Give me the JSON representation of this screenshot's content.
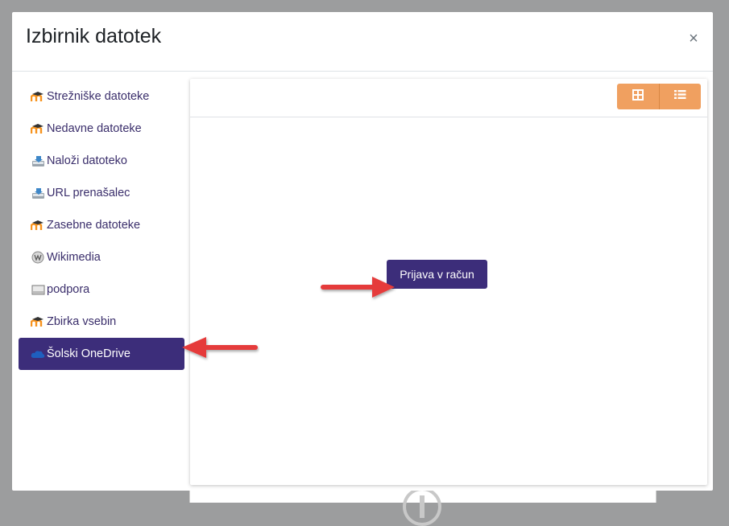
{
  "dialog": {
    "title": "Izbirnik datotek",
    "close_glyph": "×"
  },
  "sidebar": {
    "items": [
      {
        "label": "Strežniške datoteke",
        "icon": "moodle-icon",
        "active": false
      },
      {
        "label": "Nedavne datoteke",
        "icon": "moodle-icon",
        "active": false
      },
      {
        "label": "Naloži datoteko",
        "icon": "upload-icon",
        "active": false
      },
      {
        "label": "URL prenašalec",
        "icon": "upload-icon",
        "active": false
      },
      {
        "label": "Zasebne datoteke",
        "icon": "moodle-icon",
        "active": false
      },
      {
        "label": "Wikimedia",
        "icon": "wikimedia-icon",
        "active": false
      },
      {
        "label": "podpora",
        "icon": "folder-icon",
        "active": false
      },
      {
        "label": "Zbirka vsebin",
        "icon": "moodle-icon",
        "active": false
      },
      {
        "label": "Šolski OneDrive",
        "icon": "onedrive-icon",
        "active": true
      }
    ]
  },
  "toolbar": {
    "grid_view_icon": "grid-view-icon",
    "list_view_icon": "list-view-icon"
  },
  "main": {
    "login_label": "Prijava v račun"
  },
  "colors": {
    "accent": "#3c2d7a",
    "view_button": "#f0a060",
    "annotation_arrow": "#e53b3b"
  }
}
